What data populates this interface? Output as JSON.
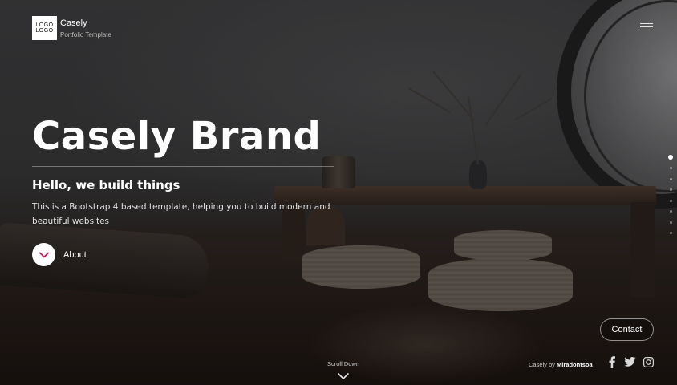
{
  "brand": {
    "logo_line1": "LOGO",
    "logo_line2": "LOGO",
    "name": "Casely",
    "tagline": "Portfolio Template"
  },
  "header": {
    "menu_icon": "hamburger-menu-icon"
  },
  "hero": {
    "title": "Casely Brand",
    "subtitle": "Hello, we build things",
    "description": "This is a Bootstrap 4 based template, helping you to build modern and beautiful websites",
    "about_label": "About",
    "about_icon": "chevron-down-icon"
  },
  "pager": {
    "dot_count": 8,
    "active_index": 0
  },
  "contact": {
    "label": "Contact"
  },
  "footer": {
    "scroll_label": "Scroll Down",
    "credit_prefix": "Casely by",
    "credit_author": "Miradontsoa",
    "social": [
      "facebook-icon",
      "twitter-icon",
      "instagram-icon"
    ]
  },
  "colors": {
    "accent": "#c2185b",
    "text": "#ffffff",
    "muted": "#bdbdbd"
  }
}
